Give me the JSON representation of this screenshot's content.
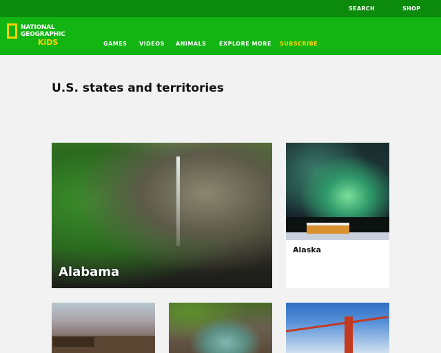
{
  "topbar": {
    "search_label": "SEARCH",
    "shop_label": "SHOP"
  },
  "logo": {
    "line1": "NATIONAL",
    "line2": "GEOGRAPHIC",
    "line3": "KiDS"
  },
  "nav": {
    "items": [
      "GAMES",
      "VIDEOS",
      "ANIMALS",
      "EXPLORE MORE"
    ],
    "subscribe_label": "SUBSCRIBE"
  },
  "page": {
    "title": "U.S. states and territories"
  },
  "cards": [
    {
      "label": "Alabama"
    },
    {
      "label": "Alaska"
    }
  ],
  "colors": {
    "topbar": "#0b8a0b",
    "navbar": "#12b512",
    "accent": "#ffd400",
    "background": "#f2f2f2"
  }
}
